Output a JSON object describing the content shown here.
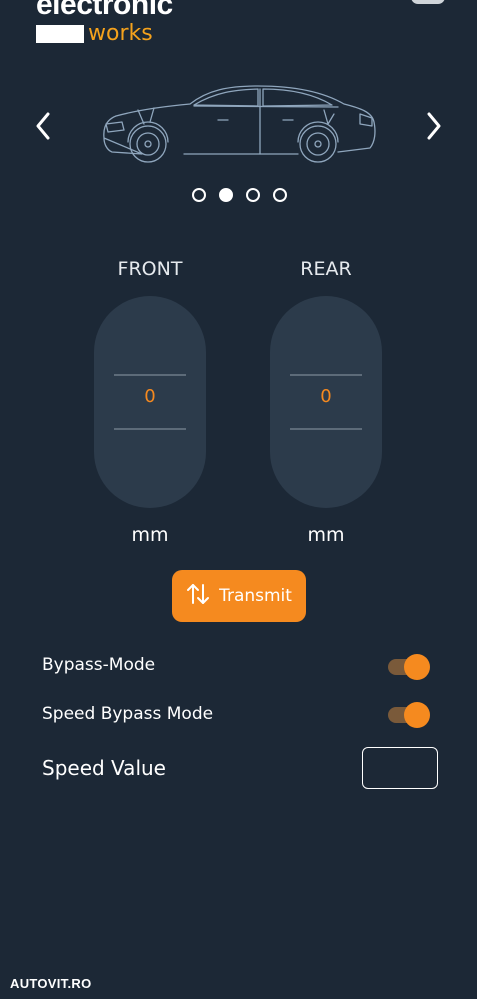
{
  "header": {
    "logo_text_top": "electronic",
    "logo_text_bottom": "works",
    "logo_accent_color": "#f5a21c"
  },
  "carousel": {
    "prev_icon": "chevron-left-icon",
    "next_icon": "chevron-right-icon",
    "image_icon": "car-icon",
    "active_index": 1,
    "page_count": 4
  },
  "axles": {
    "front": {
      "label": "FRONT",
      "value": "0",
      "unit": "mm"
    },
    "rear": {
      "label": "REAR",
      "value": "0",
      "unit": "mm"
    }
  },
  "transmit": {
    "label": "Transmit",
    "icon": "swap-vertical-icon"
  },
  "settings": {
    "bypass_mode": {
      "label": "Bypass-Mode",
      "enabled": true
    },
    "speed_bypass_mode": {
      "label": "Speed Bypass Mode",
      "enabled": true
    },
    "speed_value": {
      "label": "Speed Value",
      "value": "",
      "placeholder": ""
    }
  },
  "footer": {
    "watermark": "AUTOVIT.RO"
  },
  "colors": {
    "background": "#1c2836",
    "panel": "#2c3b4b",
    "accent": "#f58a1f"
  }
}
